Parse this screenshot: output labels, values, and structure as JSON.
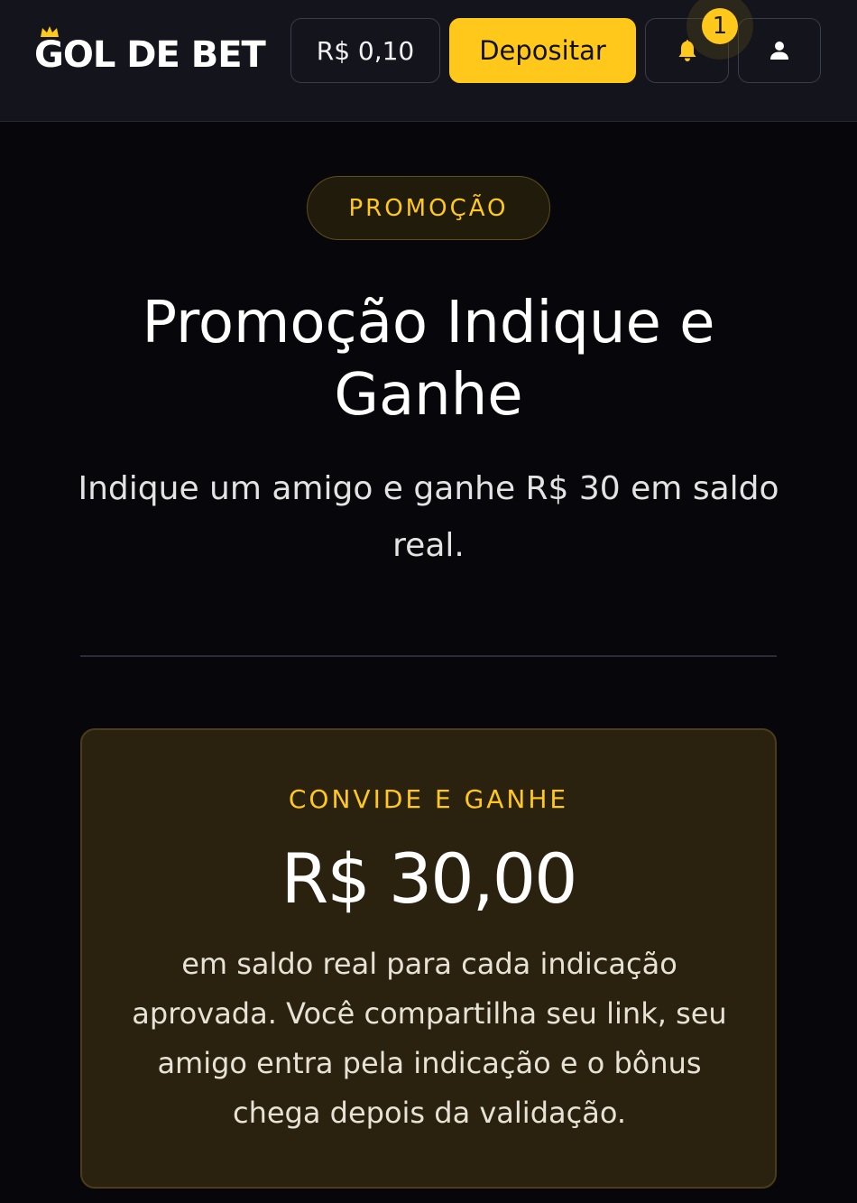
{
  "header": {
    "logo_text": "GOL DE BET",
    "balance": "R$ 0,10",
    "deposit_label": "Depositar",
    "notification_count": "1",
    "icons": {
      "notifications": "bell-icon",
      "account": "user-icon",
      "logo_accent": "crown-icon"
    }
  },
  "promo": {
    "tag": "PROMOÇÃO",
    "title": "Promoção Indique e Ganhe",
    "subtitle": "Indique um amigo e ganhe R$ 30 em saldo real."
  },
  "card": {
    "eyebrow": "CONVIDE E GANHE",
    "amount": "R$ 30,00",
    "description": "em saldo real para cada indicação aprovada. Você compartilha seu link, seu amigo entra pela indicação e o bônus chega depois da validação."
  },
  "colors": {
    "accent": "#ffc81a",
    "background": "#07070b",
    "header_background": "#13141c",
    "card_background": "#2a220f"
  }
}
